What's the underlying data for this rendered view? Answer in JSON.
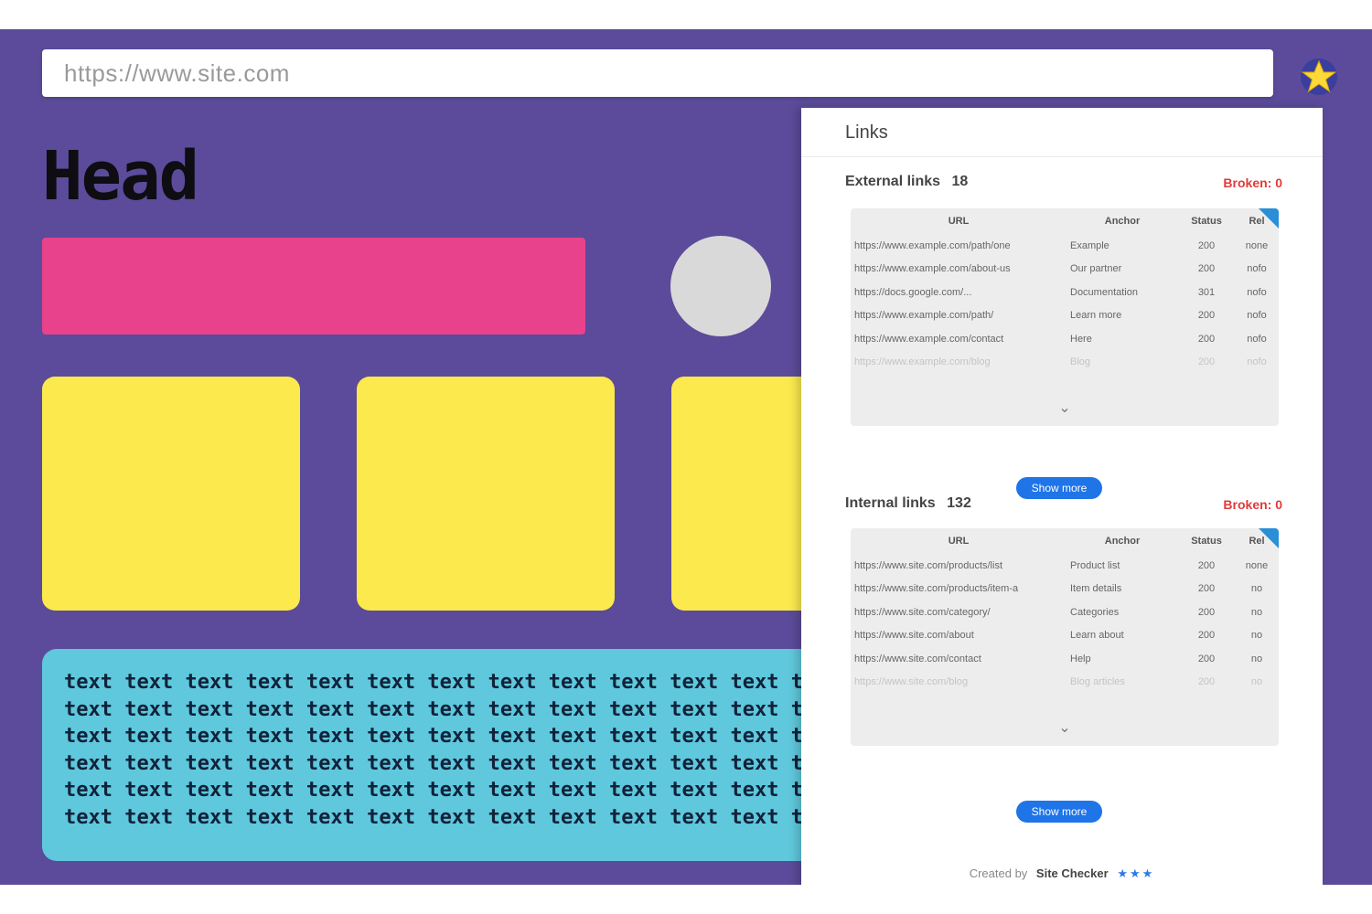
{
  "browser": {
    "url": "https://www.site.com",
    "extension_icon": "star-icon"
  },
  "page": {
    "heading": "Head",
    "text_rows": [
      "text text text text text text text text text text text text text te",
      "text text text text text text text text text text text text text te",
      "text text text text text text text text text text text text text te",
      "text text text text text text text text text text text text text te",
      "text text text text text text text text text text text text text te",
      "text text text text text text text text text text text text text te"
    ],
    "colors": {
      "background": "#5b4b9a",
      "pink_bar": "#e8428c",
      "cards": "#fbe94d",
      "text_block": "#5fc8dc"
    }
  },
  "panel": {
    "title": "Links",
    "external": {
      "title": "External links",
      "count": "18",
      "broken": "Broken: 0",
      "columns": [
        "URL",
        "Anchor",
        "Status",
        "Rel"
      ],
      "rows": [
        [
          "https://www.example.com/path/one",
          "Example",
          "200",
          "none"
        ],
        [
          "https://www.example.com/about-us",
          "Our partner",
          "200",
          "nofo"
        ],
        [
          "https://docs.google.com/...",
          "Documentation",
          "301",
          "nofo"
        ],
        [
          "https://www.example.com/path/",
          "Learn more",
          "200",
          "nofo"
        ],
        [
          "https://www.example.com/contact",
          "Here",
          "200",
          "nofo"
        ],
        [
          "https://www.example.com/blog",
          "Blog",
          "200",
          "nofo"
        ]
      ],
      "button": "Show more"
    },
    "internal": {
      "title": "Internal links",
      "count": "132",
      "broken": "Broken: 0",
      "columns": [
        "URL",
        "Anchor",
        "Status",
        "Rel"
      ],
      "rows": [
        [
          "https://www.site.com/products/list",
          "Product list",
          "200",
          "none"
        ],
        [
          "https://www.site.com/products/item-a",
          "Item details",
          "200",
          "no"
        ],
        [
          "https://www.site.com/category/",
          "Categories",
          "200",
          "no"
        ],
        [
          "https://www.site.com/about",
          "Learn about",
          "200",
          "no"
        ],
        [
          "https://www.site.com/contact",
          "Help",
          "200",
          "no"
        ],
        [
          "https://www.site.com/blog",
          "Blog articles",
          "200",
          "no"
        ]
      ],
      "button": "Show more"
    },
    "footer": {
      "label": "Created by",
      "brand": "Site Checker",
      "rating": "★★★"
    }
  }
}
